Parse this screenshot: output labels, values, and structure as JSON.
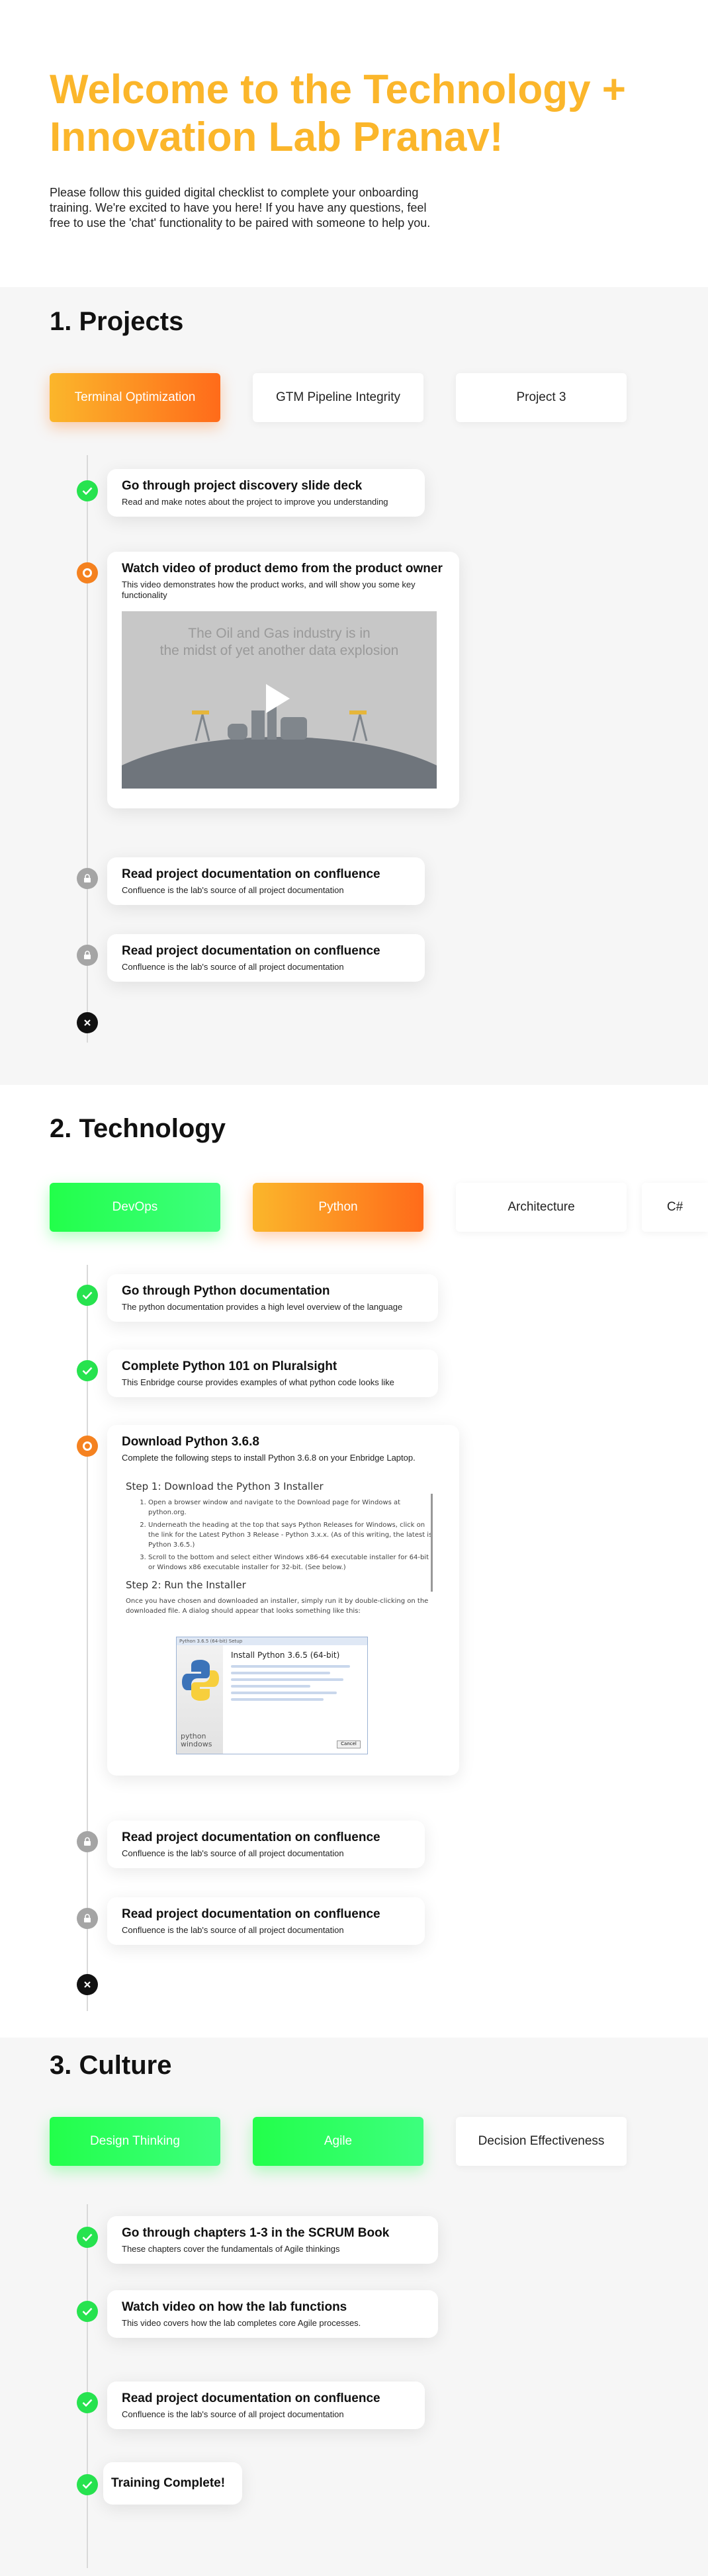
{
  "hero": {
    "title": "Welcome to the Technology + Innovation Lab Pranav!",
    "intro": "Please follow this guided digital checklist to complete your onboarding training. We're excited to have you here!  If you have any questions, feel free to use the 'chat' functionality to be paired with someone to help you."
  },
  "colors": {
    "accent_yellow": "#FBB62B",
    "accent_orange": "#FF6B1A",
    "accent_green": "#22FF4A",
    "status_done": "#27E34F",
    "status_current": "#F58220",
    "status_locked": "#A5A5A5"
  },
  "projects": {
    "title": "1. Projects",
    "tabs": [
      "Terminal Optimization",
      "GTM Pipeline Integrity",
      "Project 3"
    ],
    "steps": [
      {
        "status": "done",
        "title": "Go through project discovery slide deck",
        "desc": "Read and make notes about the project to improve you understanding"
      },
      {
        "status": "current",
        "title": "Watch video of product demo from the product owner",
        "desc": "This video demonstrates how the product works, and will show you some key functionality",
        "video": {
          "line1": "The Oil and Gas industry is in",
          "line2": "the midst of yet another data explosion"
        }
      },
      {
        "status": "locked",
        "title": "Read project documentation on confluence",
        "desc": "Confluence is the lab's source of all project documentation"
      },
      {
        "status": "locked",
        "title": "Read project documentation on confluence",
        "desc": "Confluence is the lab's source of all project documentation"
      }
    ]
  },
  "technology": {
    "title": "2. Technology",
    "tabs": [
      "DevOps",
      "Python",
      "Architecture",
      "C#"
    ],
    "steps": [
      {
        "status": "done",
        "title": "Go through Python documentation",
        "desc": "The python documentation provides a high level overview of the language"
      },
      {
        "status": "done",
        "title": "Complete Python 101 on Pluralsight",
        "desc": "This Enbridge course provides examples of what python code looks like"
      },
      {
        "status": "current",
        "title": "Download Python 3.6.8",
        "desc": "Complete the following steps to install Python 3.6.8 on your Enbridge Laptop.",
        "doc": {
          "step1": "Step 1: Download the Python 3 Installer",
          "items": [
            "Open a browser window and navigate to the Download page for Windows at python.org.",
            "Underneath the heading at the top that says Python Releases for Windows, click on the link for the Latest Python 3 Release - Python 3.x.x. (As of this writing, the latest is Python 3.6.5.)",
            "Scroll to the bottom and select either Windows x86-64 executable installer for 64-bit or Windows x86 executable installer for 32-bit. (See below.)"
          ],
          "step2": "Step 2: Run the Installer",
          "step2_text": "Once you have chosen and downloaded an installer, simply run it by double-clicking on the downloaded file. A dialog should appear that looks something like this:",
          "dialog_title": "Install Python 3.6.5 (64-bit)",
          "dialog_bar": "Python 3.6.5 (64-bit) Setup",
          "dialog_cancel": "Cancel",
          "dialog_brand": "python windows"
        }
      },
      {
        "status": "locked",
        "title": "Read project documentation on confluence",
        "desc": "Confluence is the lab's source of all project documentation"
      },
      {
        "status": "locked",
        "title": "Read project documentation on confluence",
        "desc": "Confluence is the lab's source of all project documentation"
      }
    ]
  },
  "culture": {
    "title": "3. Culture",
    "tabs": [
      "Design Thinking",
      "Agile",
      "Decision Effectiveness"
    ],
    "steps": [
      {
        "status": "done",
        "title": "Go through chapters 1-3 in the SCRUM Book",
        "desc": "These chapters cover the fundamentals of Agile thinkings"
      },
      {
        "status": "done",
        "title": "Watch video on how the lab functions",
        "desc": "This video covers how the lab completes core Agile processes."
      },
      {
        "status": "done",
        "title": "Read project documentation on confluence",
        "desc": "Confluence is the lab's source of all project documentation"
      },
      {
        "status": "done",
        "title": "Training Complete!"
      }
    ]
  }
}
